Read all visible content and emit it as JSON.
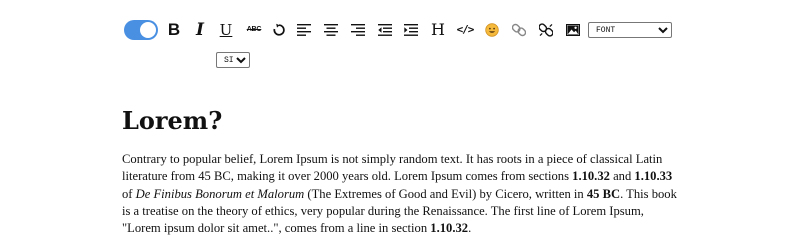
{
  "toolbar": {
    "toggle": {
      "state": "on",
      "color": "#4a90e2"
    },
    "buttons": {
      "bold": {
        "label": "B",
        "icon": "bold-icon"
      },
      "italic": {
        "label": "I",
        "icon": "italic-icon"
      },
      "underline": {
        "label": "U",
        "icon": "underline-icon"
      },
      "strikethrough": {
        "label": "ABC",
        "icon": "strikethrough-icon"
      },
      "undo": {
        "icon": "undo-icon"
      },
      "align_left": {
        "icon": "align-left-icon"
      },
      "align_center": {
        "icon": "align-center-icon"
      },
      "align_right": {
        "icon": "align-right-icon"
      },
      "outdent": {
        "icon": "outdent-icon"
      },
      "indent": {
        "icon": "indent-icon"
      },
      "heading": {
        "label": "H",
        "icon": "heading-icon"
      },
      "code": {
        "label": "</>",
        "icon": "code-icon"
      },
      "emoji": {
        "icon": "emoji-icon"
      },
      "link": {
        "icon": "link-icon"
      },
      "unlink": {
        "icon": "unlink-icon"
      },
      "image": {
        "icon": "image-icon"
      }
    },
    "font_select": {
      "selected": "FONT",
      "options": [
        "FONT"
      ]
    },
    "size_select": {
      "selected": "SIZE",
      "options": [
        "SIZE"
      ]
    }
  },
  "content": {
    "title": "Lorem?",
    "paragraph": {
      "t1": "Contrary to popular belief, Lorem Ipsum is not simply random text. It has roots in a piece of classical Latin literature from 45 BC, making it over 2000 years old. Lorem Ipsum comes from sections ",
      "b1": "1.10.32",
      "t2": " and ",
      "b2": "1.10.33",
      "t3": " of ",
      "i1": "De Finibus Bonorum et Malorum",
      "t4": " (The Extremes of Good and Evil) by Cicero, written in ",
      "b3": "45 BC",
      "t5": ". This book is a treatise on the theory of ethics, very popular during the Renaissance. The first line of Lorem Ipsum, \"Lorem ipsum dolor sit amet..\", comes from a line in section ",
      "b4": "1.10.32",
      "t6": "."
    }
  }
}
